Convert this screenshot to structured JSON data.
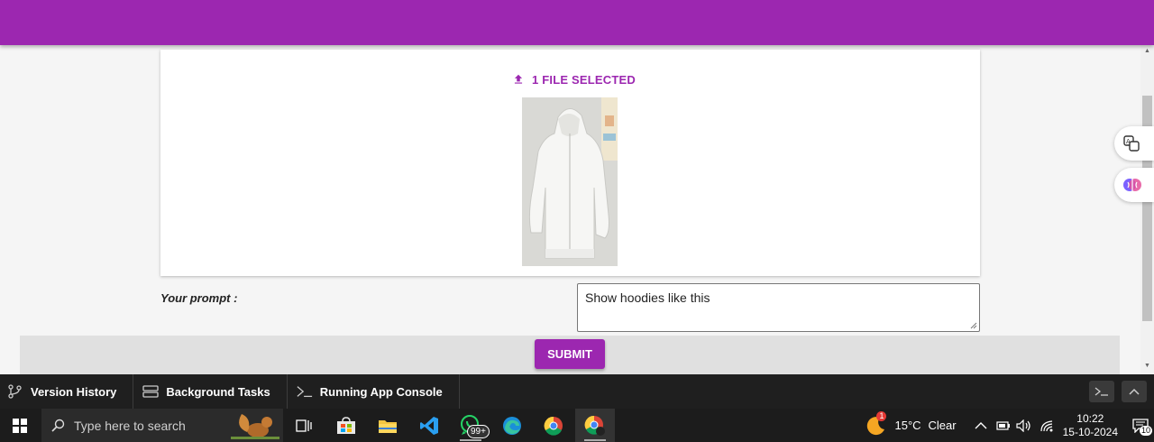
{
  "upload": {
    "label": "1 FILE SELECTED"
  },
  "prompt": {
    "label": "Your prompt :",
    "value": "Show hoodies like this"
  },
  "submit": {
    "label": "SUBMIT"
  },
  "devbar": {
    "tabs": [
      {
        "label": "Version History",
        "icon": "branch-icon"
      },
      {
        "label": "Background Tasks",
        "icon": "server-icon"
      },
      {
        "label": "Running App Console",
        "icon": "terminal-icon"
      }
    ]
  },
  "taskbar": {
    "search_placeholder": "Type here to search",
    "whatsapp_badge": "99+",
    "weather_badge": "1",
    "temperature": "15°C",
    "weather": "Clear",
    "time": "10:22",
    "date": "15-10-2024",
    "notification_count": "10"
  },
  "colors": {
    "accent": "#9c27b0",
    "taskbar": "#1c1c1c",
    "devbar": "#1f1f1f"
  }
}
